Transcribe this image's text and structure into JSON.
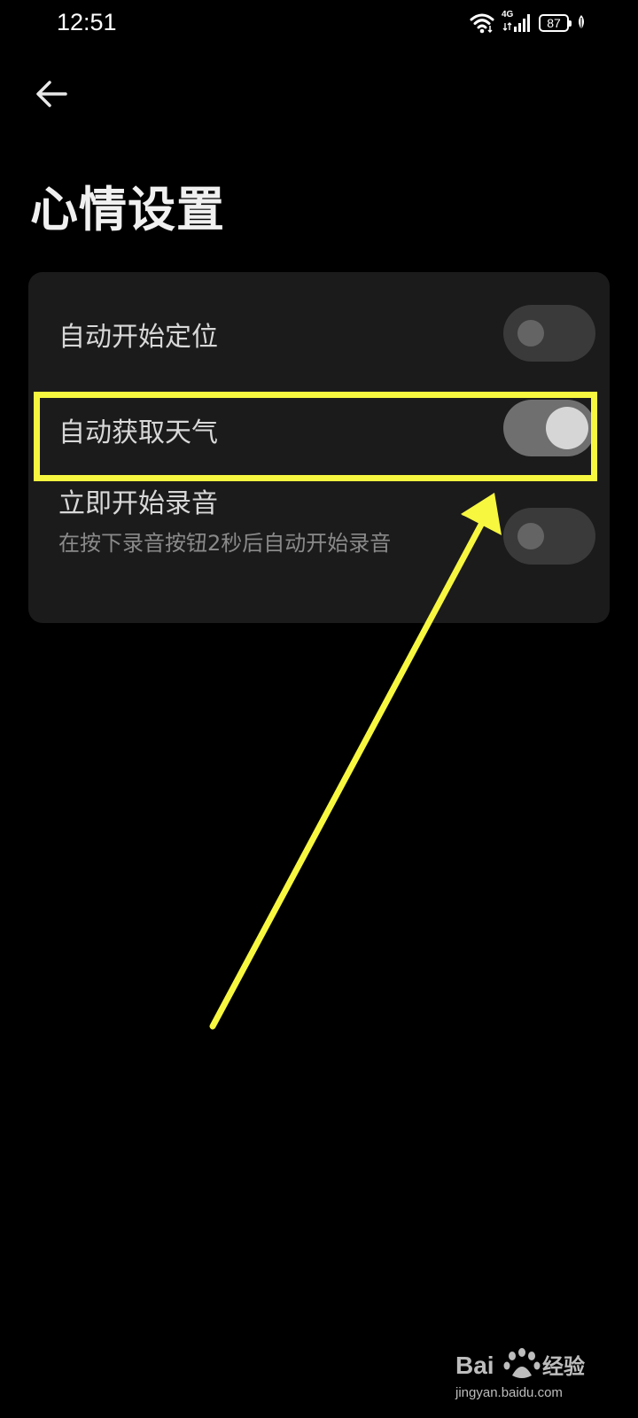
{
  "status_bar": {
    "time": "12:51",
    "network": "4G",
    "battery": "87"
  },
  "header": {
    "back_icon": "arrow-left-icon",
    "title": "心情设置"
  },
  "settings": [
    {
      "label": "自动开始定位",
      "description": "",
      "enabled": false
    },
    {
      "label": "自动获取天气",
      "description": "",
      "enabled": true
    },
    {
      "label": "立即开始录音",
      "description": "在按下录音按钮2秒后自动开始录音",
      "enabled": false
    }
  ],
  "annotation": {
    "color": "#f7f740"
  },
  "watermark": {
    "brand": "Baidu经验",
    "url": "jingyan.baidu.com"
  },
  "colors": {
    "background": "#000000",
    "card": "#1b1b1b",
    "accent": "#f7f740"
  }
}
